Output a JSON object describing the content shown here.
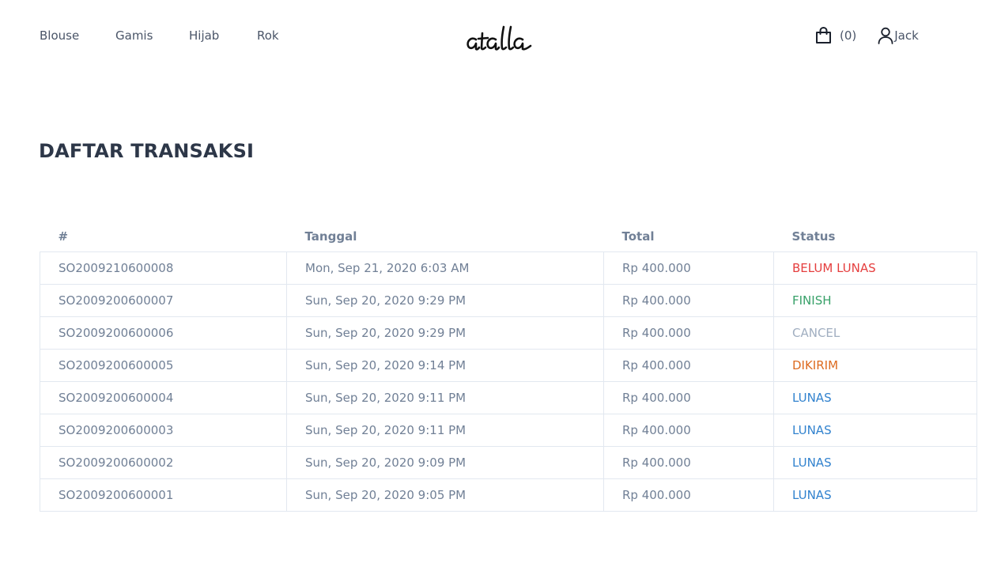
{
  "nav": {
    "items": [
      {
        "label": "Blouse"
      },
      {
        "label": "Gamis"
      },
      {
        "label": "Hijab"
      },
      {
        "label": "Rok"
      }
    ]
  },
  "brand": {
    "logo_text": "atalla"
  },
  "header": {
    "cart_count": "(0)",
    "user_name": "Jack",
    "cart_icon": "shopping-bag-icon",
    "user_icon": "user-icon"
  },
  "page": {
    "title": "DAFTAR TRANSAKSI"
  },
  "table": {
    "columns": [
      "#",
      "Tanggal",
      "Total",
      "Status"
    ],
    "rows": [
      {
        "id": "SO2009210600008",
        "date": "Mon, Sep 21, 2020 6:03 AM",
        "total": "Rp 400.000",
        "status": "BELUM LUNAS",
        "status_color": "#e53e3e"
      },
      {
        "id": "SO2009200600007",
        "date": "Sun, Sep 20, 2020 9:29 PM",
        "total": "Rp 400.000",
        "status": "FINISH",
        "status_color": "#38a169"
      },
      {
        "id": "SO2009200600006",
        "date": "Sun, Sep 20, 2020 9:29 PM",
        "total": "Rp 400.000",
        "status": "CANCEL",
        "status_color": "#a0aec0"
      },
      {
        "id": "SO2009200600005",
        "date": "Sun, Sep 20, 2020 9:14 PM",
        "total": "Rp 400.000",
        "status": "DIKIRIM",
        "status_color": "#dd6b20"
      },
      {
        "id": "SO2009200600004",
        "date": "Sun, Sep 20, 2020 9:11 PM",
        "total": "Rp 400.000",
        "status": "LUNAS",
        "status_color": "#3182ce"
      },
      {
        "id": "SO2009200600003",
        "date": "Sun, Sep 20, 2020 9:11 PM",
        "total": "Rp 400.000",
        "status": "LUNAS",
        "status_color": "#3182ce"
      },
      {
        "id": "SO2009200600002",
        "date": "Sun, Sep 20, 2020 9:09 PM",
        "total": "Rp 400.000",
        "status": "LUNAS",
        "status_color": "#3182ce"
      },
      {
        "id": "SO2009200600001",
        "date": "Sun, Sep 20, 2020 9:05 PM",
        "total": "Rp 400.000",
        "status": "LUNAS",
        "status_color": "#3182ce"
      }
    ]
  }
}
